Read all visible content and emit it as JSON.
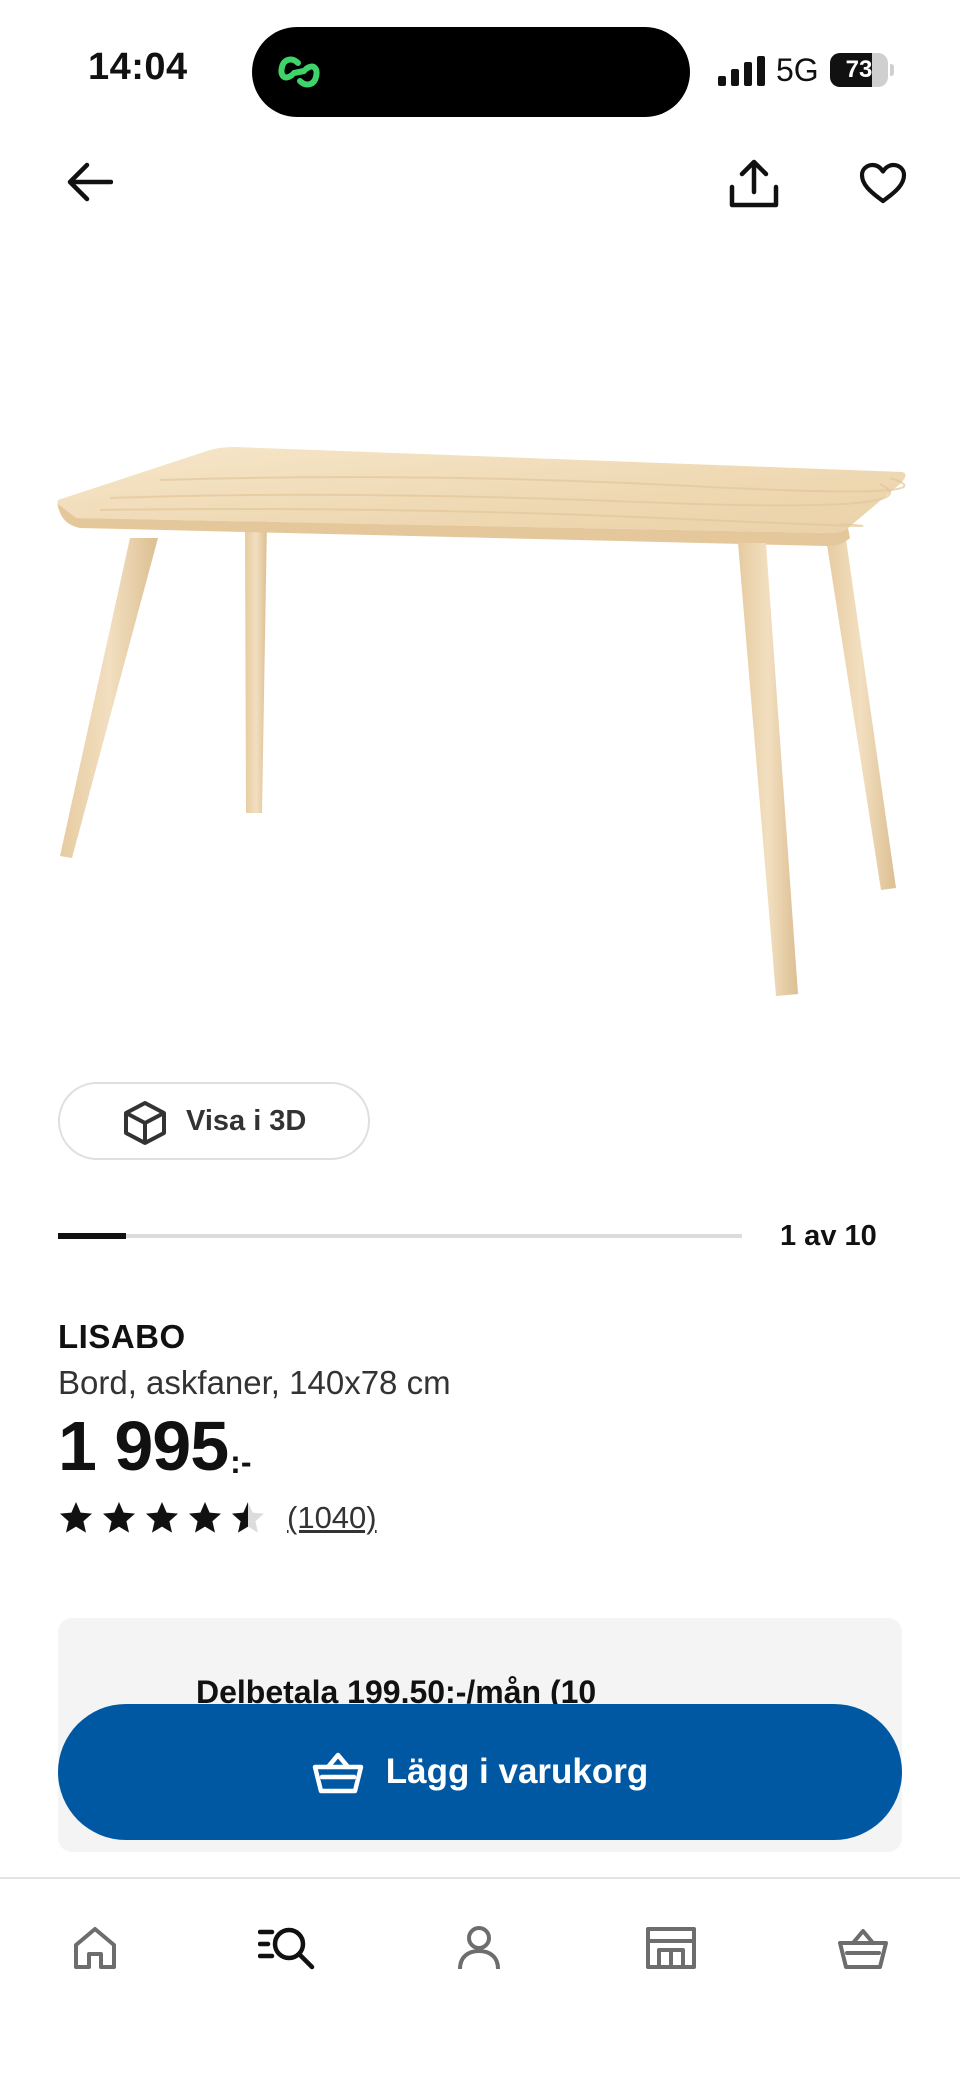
{
  "status_bar": {
    "time": "14:04",
    "network": "5G",
    "battery_level": "73",
    "battery_fraction": 0.73
  },
  "top_nav": {
    "back_icon": "arrow-left-icon",
    "share_icon": "share-icon",
    "favorite_icon": "heart-icon"
  },
  "gallery": {
    "view3d_label": "Visa i 3D",
    "counter": "1 av 10",
    "current": 1,
    "total": 10
  },
  "product": {
    "name": "LISABO",
    "description": "Bord, askfaner, 140x78 cm",
    "price": "1 995",
    "price_suffix": ":-",
    "rating": 4.5,
    "review_count": "(1040)"
  },
  "installment": {
    "text": "Delbetala 199.50:-/mån (10"
  },
  "cta": {
    "add_to_cart_label": "Lägg i varukorg"
  },
  "tab_bar": {
    "items": [
      {
        "icon": "home-icon",
        "active": false
      },
      {
        "icon": "search-icon",
        "active": true
      },
      {
        "icon": "profile-icon",
        "active": false
      },
      {
        "icon": "store-icon",
        "active": false
      },
      {
        "icon": "cart-icon",
        "active": false
      }
    ]
  },
  "colors": {
    "primary": "#0058a3",
    "text": "#111111",
    "panel": "#f4f4f4",
    "wood": "#efd9b4",
    "island_accent": "#3fd46a"
  }
}
